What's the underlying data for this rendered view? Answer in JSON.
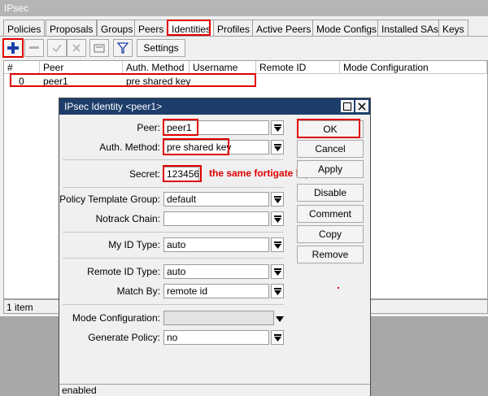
{
  "window": {
    "title": "IPsec"
  },
  "tabs": [
    "Policies",
    "Proposals",
    "Groups",
    "Peers",
    "Identities",
    "Profiles",
    "Active Peers",
    "Mode Configs",
    "Installed SAs",
    "Keys"
  ],
  "active_tab": "Identities",
  "toolbar": {
    "settings_label": "Settings"
  },
  "table": {
    "columns": [
      "#",
      "Peer",
      "Auth. Method",
      "Username",
      "Remote ID",
      "Mode Configuration"
    ],
    "rows": [
      {
        "num": "0",
        "peer": "peer1",
        "auth_method": "pre shared key",
        "username": "",
        "remote_id": "",
        "mode_config": ""
      }
    ]
  },
  "status": {
    "items": "1 item"
  },
  "dialog": {
    "title": "IPsec Identity <peer1>",
    "fields": {
      "peer": {
        "label": "Peer:",
        "value": "peer1"
      },
      "auth_method": {
        "label": "Auth. Method:",
        "value": "pre shared key"
      },
      "secret": {
        "label": "Secret:",
        "value": "123456"
      },
      "policy_template_group": {
        "label": "Policy Template Group:",
        "value": "default"
      },
      "notrack_chain": {
        "label": "Notrack Chain:",
        "value": ""
      },
      "my_id_type": {
        "label": "My ID Type:",
        "value": "auto"
      },
      "remote_id_type": {
        "label": "Remote ID Type:",
        "value": "auto"
      },
      "match_by": {
        "label": "Match By:",
        "value": "remote id"
      },
      "mode_configuration": {
        "label": "Mode Configuration:",
        "value": ""
      },
      "generate_policy": {
        "label": "Generate Policy:",
        "value": "no"
      }
    },
    "buttons": {
      "ok": "OK",
      "cancel": "Cancel",
      "apply": "Apply",
      "disable": "Disable",
      "comment": "Comment",
      "copy": "Copy",
      "remove": "Remove"
    },
    "annotation": "the same fortigate hq",
    "status": "enabled"
  },
  "colors": {
    "annotation_red": "#e00000",
    "dialog_title_bg": "#1d3d6b",
    "add_icon_blue": "#1a3fa8"
  }
}
